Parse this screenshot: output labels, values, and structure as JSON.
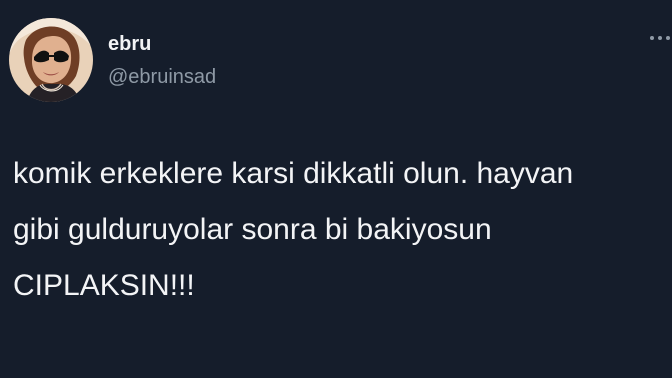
{
  "author": {
    "display_name": "ebru",
    "handle": "@ebruinsad"
  },
  "header": {
    "more_icon": "more-horizontal-icon"
  },
  "tweet": {
    "lines": [
      "komik erkeklere karsi dikkatli olun. hayvan",
      "gibi gulduruyolar sonra bi bakiyosun",
      "CIPLAKSIN!!!"
    ]
  },
  "colors": {
    "background": "#151d2b",
    "text": "#f3f4f6",
    "secondary_text": "#8f9aa6"
  }
}
